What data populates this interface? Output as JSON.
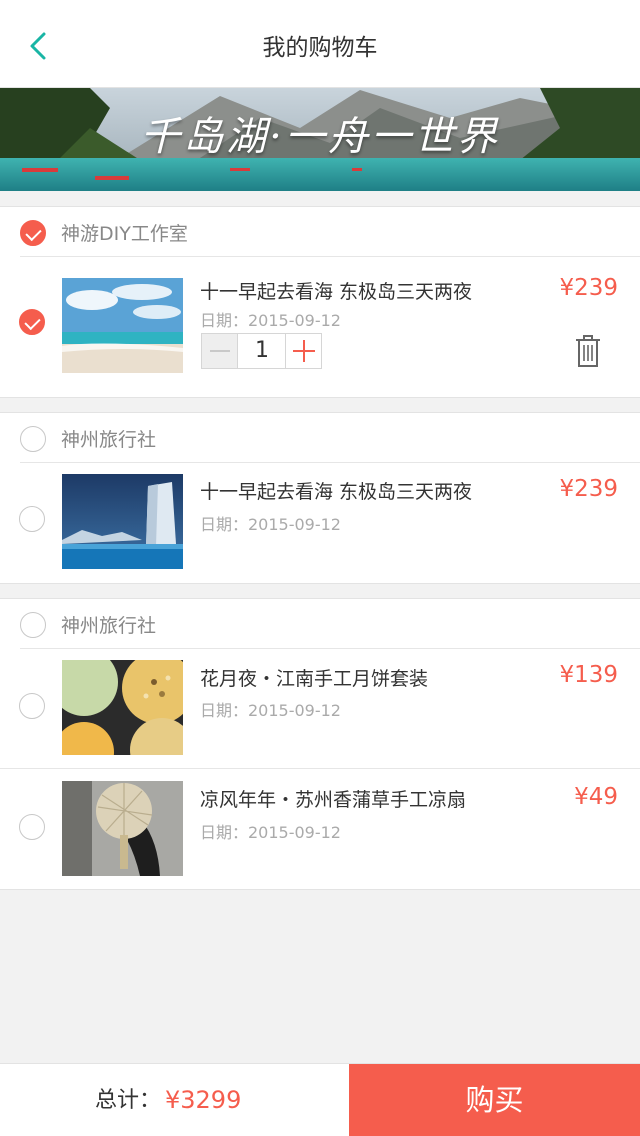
{
  "header": {
    "title": "我的购物车",
    "back_icon": "chevron-left-icon"
  },
  "banner": {
    "caption": "千岛湖·一舟一世界"
  },
  "colors": {
    "accent": "#f55d4d",
    "back_icon": "#19b5a5"
  },
  "shops": [
    {
      "name": "神游DIY工作室",
      "checked": true,
      "items": [
        {
          "title": "十一早起去看海 东极岛三天两夜",
          "date": "日期：2015-09-12",
          "price": "¥239",
          "checked": true,
          "quantity": "1",
          "image": "beach-photo"
        }
      ]
    },
    {
      "name": "神州旅行社",
      "checked": false,
      "items": [
        {
          "title": "十一早起去看海 东极岛三天两夜",
          "date": "日期：2015-09-12",
          "price": "¥239",
          "checked": false,
          "image": "iceberg-photo"
        }
      ]
    },
    {
      "name": "神州旅行社",
      "checked": false,
      "items": [
        {
          "title": "花月夜・江南手工月饼套装",
          "date": "日期：2015-09-12",
          "price": "¥139",
          "checked": false,
          "image": "mooncake-photo"
        },
        {
          "title": "凉风年年・苏州香蒲草手工凉扇",
          "date": "日期：2015-09-12",
          "price": "¥49",
          "checked": false,
          "image": "straw-fan-photo"
        }
      ]
    }
  ],
  "footer": {
    "total_label": "总计：",
    "total_value": "¥3299",
    "buy_label": "购买"
  }
}
